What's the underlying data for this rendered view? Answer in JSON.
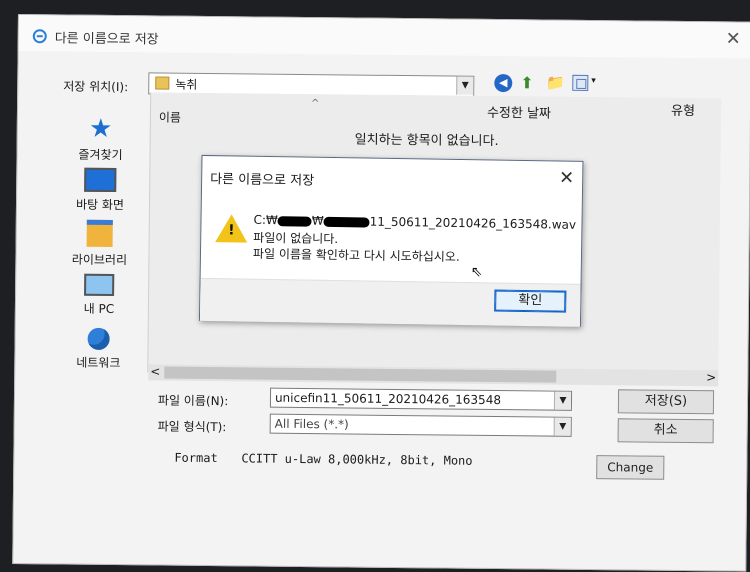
{
  "window": {
    "title": "다른 이름으로 저장",
    "close_glyph": "✕"
  },
  "toolbar": {
    "save_location_label": "저장 위치(I):",
    "save_location_value": "녹취",
    "dropdown_glyph": "▼",
    "back_glyph": "◀",
    "up_glyph": "⬆",
    "newfolder_glyph": "📁",
    "view_caret": "▾"
  },
  "places": [
    {
      "label": "즐겨찾기",
      "icon": "star-icon"
    },
    {
      "label": "바탕 화면",
      "icon": "desktop-icon"
    },
    {
      "label": "라이브러리",
      "icon": "library-icon"
    },
    {
      "label": "내 PC",
      "icon": "pc-icon"
    },
    {
      "label": "네트워크",
      "icon": "network-icon"
    }
  ],
  "file_list": {
    "columns": {
      "name": "이름",
      "modified": "수정한 날짜",
      "type": "유형"
    },
    "sort_glyph": "^",
    "empty_message": "일치하는 항목이 없습니다.",
    "scroll_left": "<",
    "scroll_right": ">"
  },
  "form": {
    "filename_label": "파일 이름(N):",
    "filename_value": "unicefin11_50611_20210426_163548",
    "filetype_label": "파일 형식(T):",
    "filetype_value": "All Files (*.*)",
    "save_button": "저장(S)",
    "cancel_button": "취소",
    "format_label": "Format",
    "format_value": "CCITT u-Law 8,000kHz, 8bit, Mono",
    "change_button": "Change"
  },
  "message_box": {
    "title": "다른 이름으로 저장",
    "close_glyph": "✕",
    "warning_glyph": "!",
    "path_prefix": "C:₩",
    "path_mid": "₩",
    "path_suffix": "11_50611_20210426_163548.wav",
    "line2": "파일이 없습니다.",
    "line3": "파일 이름을 확인하고 다시 시도하십시오.",
    "ok_button": "확인",
    "cursor_glyph": "⇖"
  },
  "colors": {
    "accent": "#0f62c9",
    "warning": "#f2c318",
    "folder": "#e8c35a"
  }
}
